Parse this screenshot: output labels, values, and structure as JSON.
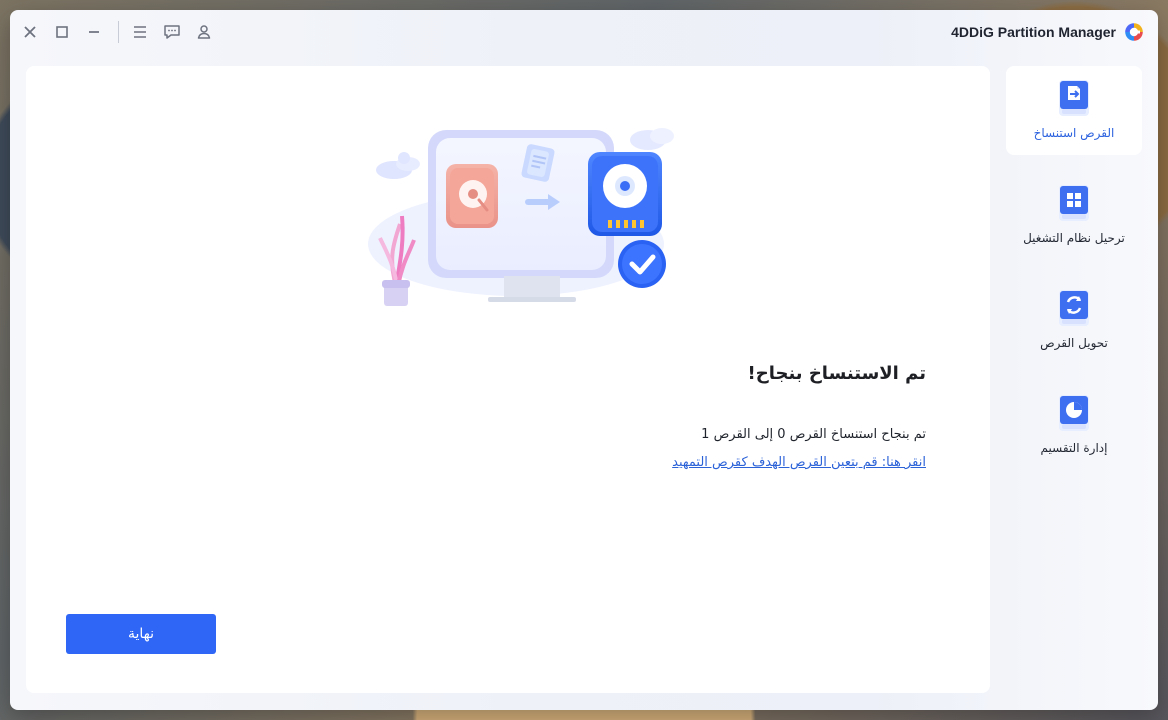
{
  "window": {
    "title": "4DDiG Partition Manager"
  },
  "window_controls": [
    {
      "name": "close-icon"
    },
    {
      "name": "maximize-icon"
    },
    {
      "name": "minimize-icon"
    },
    {
      "name": "menu-icon"
    },
    {
      "name": "feedback-icon"
    },
    {
      "name": "account-icon"
    }
  ],
  "main": {
    "success_title": "تم الاستنساخ بنجاح!",
    "success_description": "تم بنجاح استنساخ القرص 0 إلى القرص 1",
    "success_link": "انقر هنا: قم بتعين القرص الهدف كقرص التمهيد",
    "finish_button": "نهاية"
  },
  "sidebar": {
    "items": [
      {
        "label": "القرص استنساخ",
        "icon": "clone-disk-icon",
        "active": true
      },
      {
        "label": "ترحيل نظام التشغيل",
        "icon": "migrate-os-icon",
        "active": false
      },
      {
        "label": "تحويل القرص",
        "icon": "convert-disk-icon",
        "active": false
      },
      {
        "label": "إدارة التقسيم",
        "icon": "partition-manager-icon",
        "active": false
      }
    ]
  },
  "colors": {
    "accent": "#2f66f6",
    "link": "#2b62d8",
    "active_nav_text": "#2d63df",
    "panel_background": "#ffffff",
    "app_background": "#eef1f8"
  }
}
